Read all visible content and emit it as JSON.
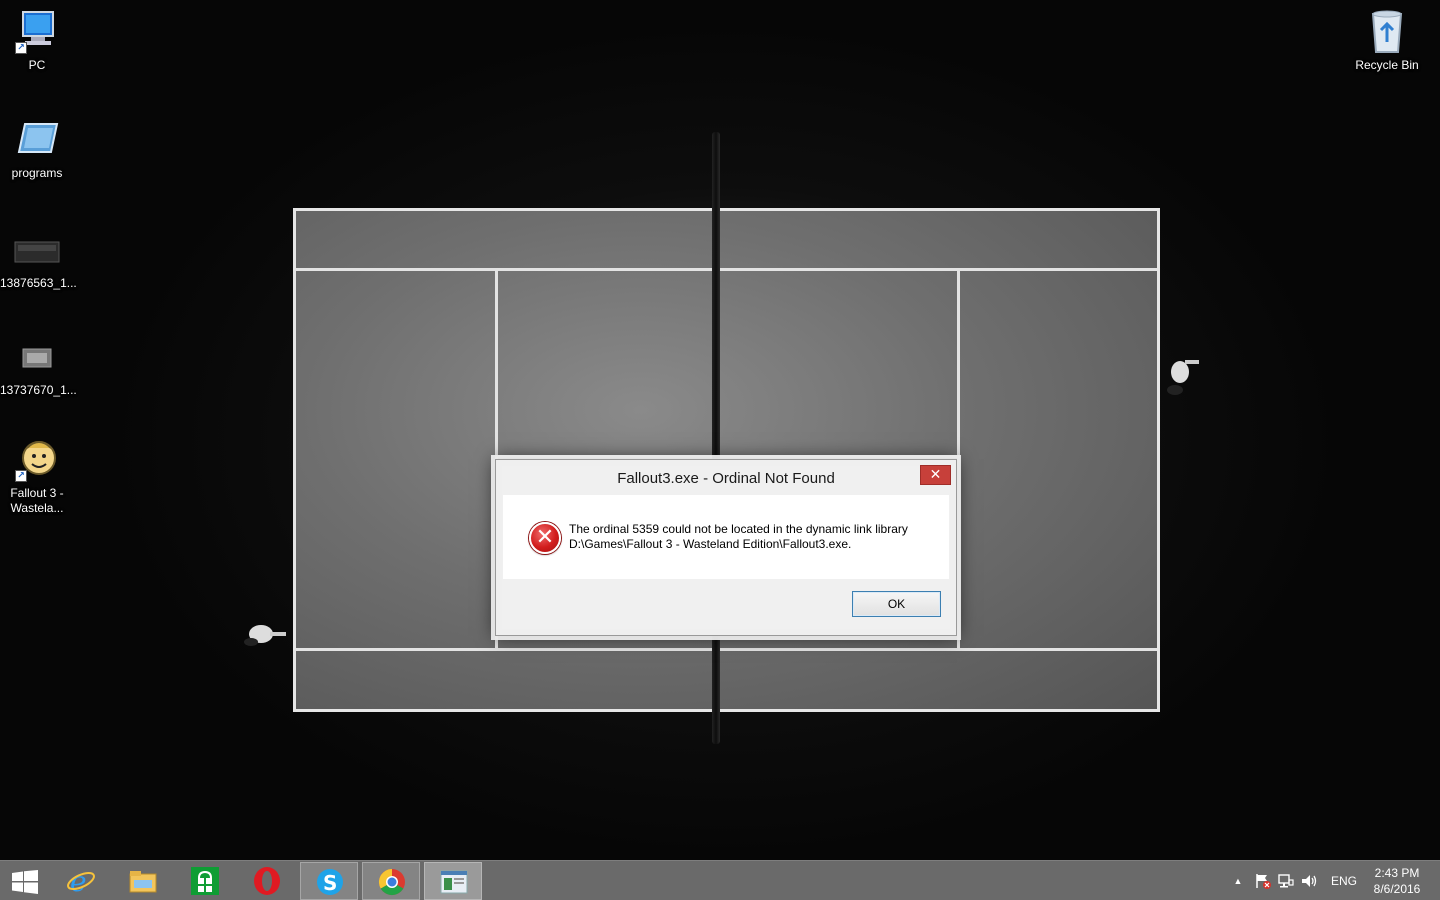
{
  "desktop": {
    "icons": [
      {
        "label": "PC",
        "icon": "computer-icon"
      },
      {
        "label": "programs",
        "icon": "folder-drive-icon"
      },
      {
        "label": "13876563_1...",
        "icon": "image-file-icon"
      },
      {
        "label": "13737670_1...",
        "icon": "image-file-icon"
      },
      {
        "label": "Fallout 3 - Wastela...",
        "icon": "vault-boy-icon"
      },
      {
        "label": "Recycle Bin",
        "icon": "recycle-bin-icon"
      }
    ]
  },
  "dialog": {
    "title": "Fallout3.exe - Ordinal Not Found",
    "close_glyph": "✕",
    "message_line1": "The ordinal 5359 could not be located in the dynamic link library",
    "message_line2": "D:\\Games\\Fallout 3 - Wasteland Edition\\Fallout3.exe.",
    "ok_label": "OK",
    "error_glyph": "✕"
  },
  "taskbar": {
    "apps": [
      {
        "name": "start-button",
        "icon": "windows-logo-icon"
      },
      {
        "name": "internet-explorer",
        "icon": "ie-icon"
      },
      {
        "name": "file-explorer",
        "icon": "folder-icon"
      },
      {
        "name": "windows-store",
        "icon": "store-icon"
      },
      {
        "name": "opera",
        "icon": "opera-icon"
      },
      {
        "name": "skype",
        "icon": "skype-icon"
      },
      {
        "name": "chrome",
        "icon": "chrome-icon"
      },
      {
        "name": "active-window",
        "icon": "window-app-icon"
      }
    ],
    "tray": {
      "up_arrow": "▲",
      "language": "ENG"
    },
    "clock": {
      "time": "2:43 PM",
      "date": "8/6/2016"
    }
  },
  "colors": {
    "taskbar": "#6a6a6a",
    "close_red": "#c7403a",
    "error_red": "#d21d1d"
  }
}
